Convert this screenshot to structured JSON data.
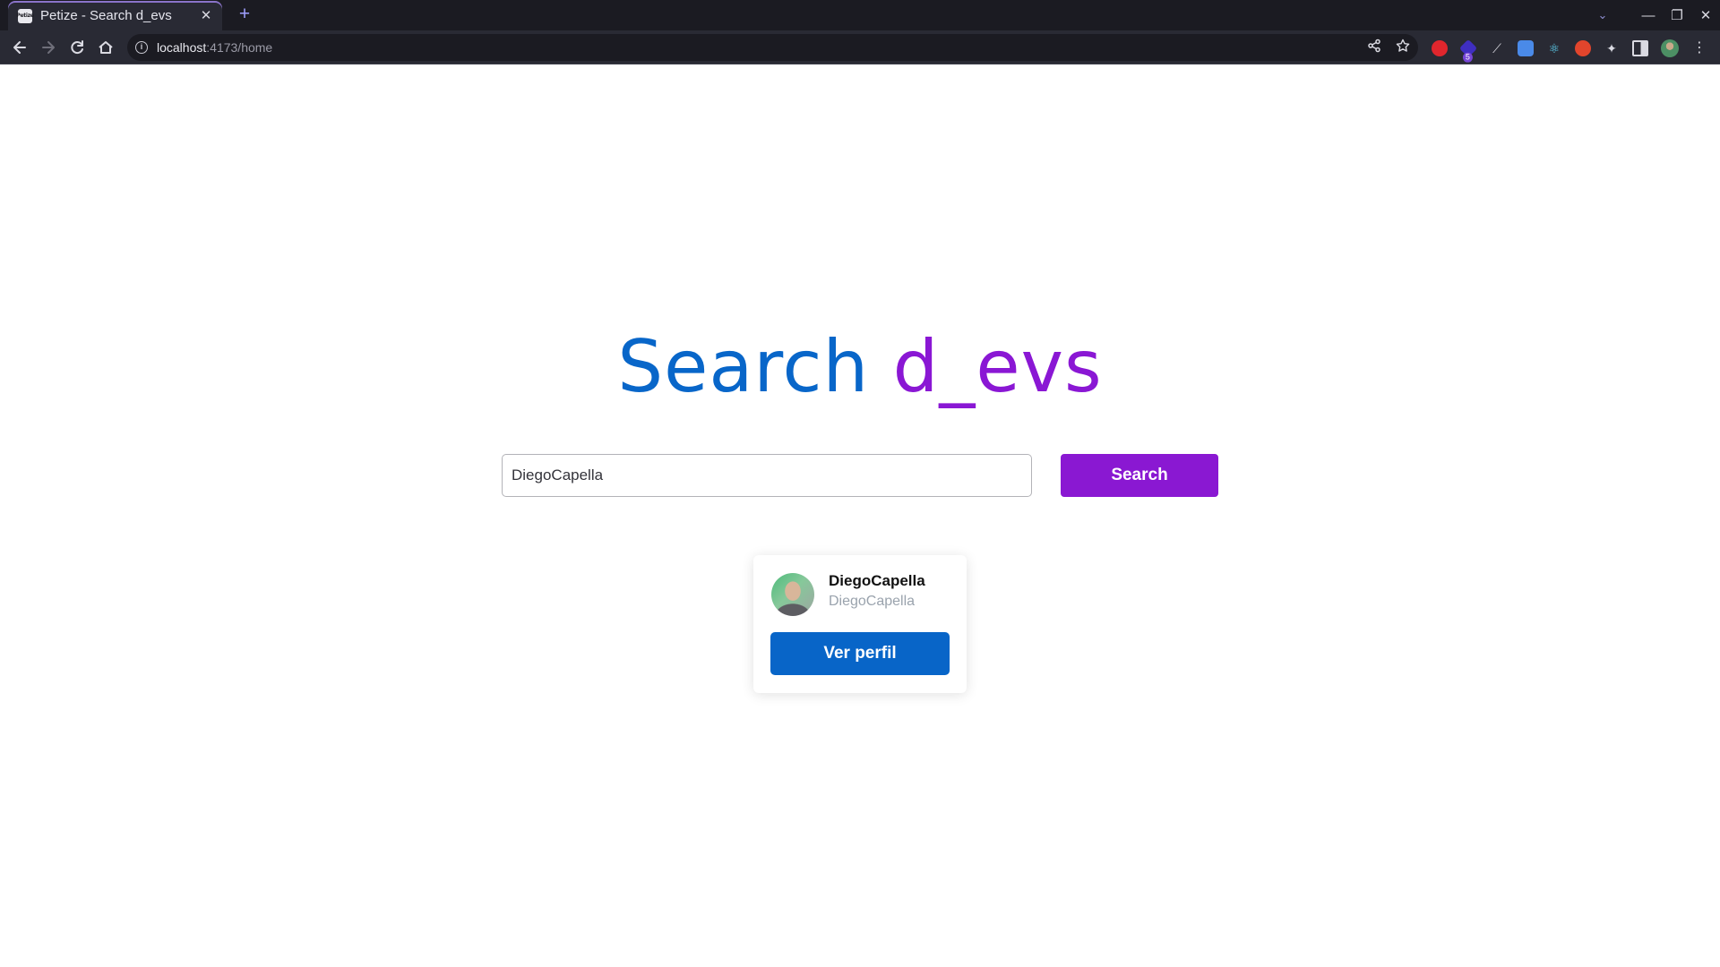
{
  "browser": {
    "tab": {
      "title": "Petize - Search d_evs",
      "favicon_text": "Petize",
      "close_glyph": "✕"
    },
    "new_tab_glyph": "+",
    "address": {
      "host": "localhost",
      "rest": ":4173/home"
    },
    "window_controls": {
      "tab_search": "⌄",
      "minimize": "—",
      "restore": "❐",
      "close": "✕"
    },
    "extension_badge": "5"
  },
  "page": {
    "heading_part1": "Search",
    "heading_part2": "d_evs",
    "search": {
      "value": "DiegoCapella",
      "button_label": "Search"
    },
    "result": {
      "name": "DiegoCapella",
      "login": "DiegoCapella",
      "button_label": "Ver perfil"
    }
  },
  "colors": {
    "heading_blue": "#0866c9",
    "heading_purple": "#8a17d4",
    "search_button": "#8a18d2",
    "profile_button": "#0865c8"
  }
}
